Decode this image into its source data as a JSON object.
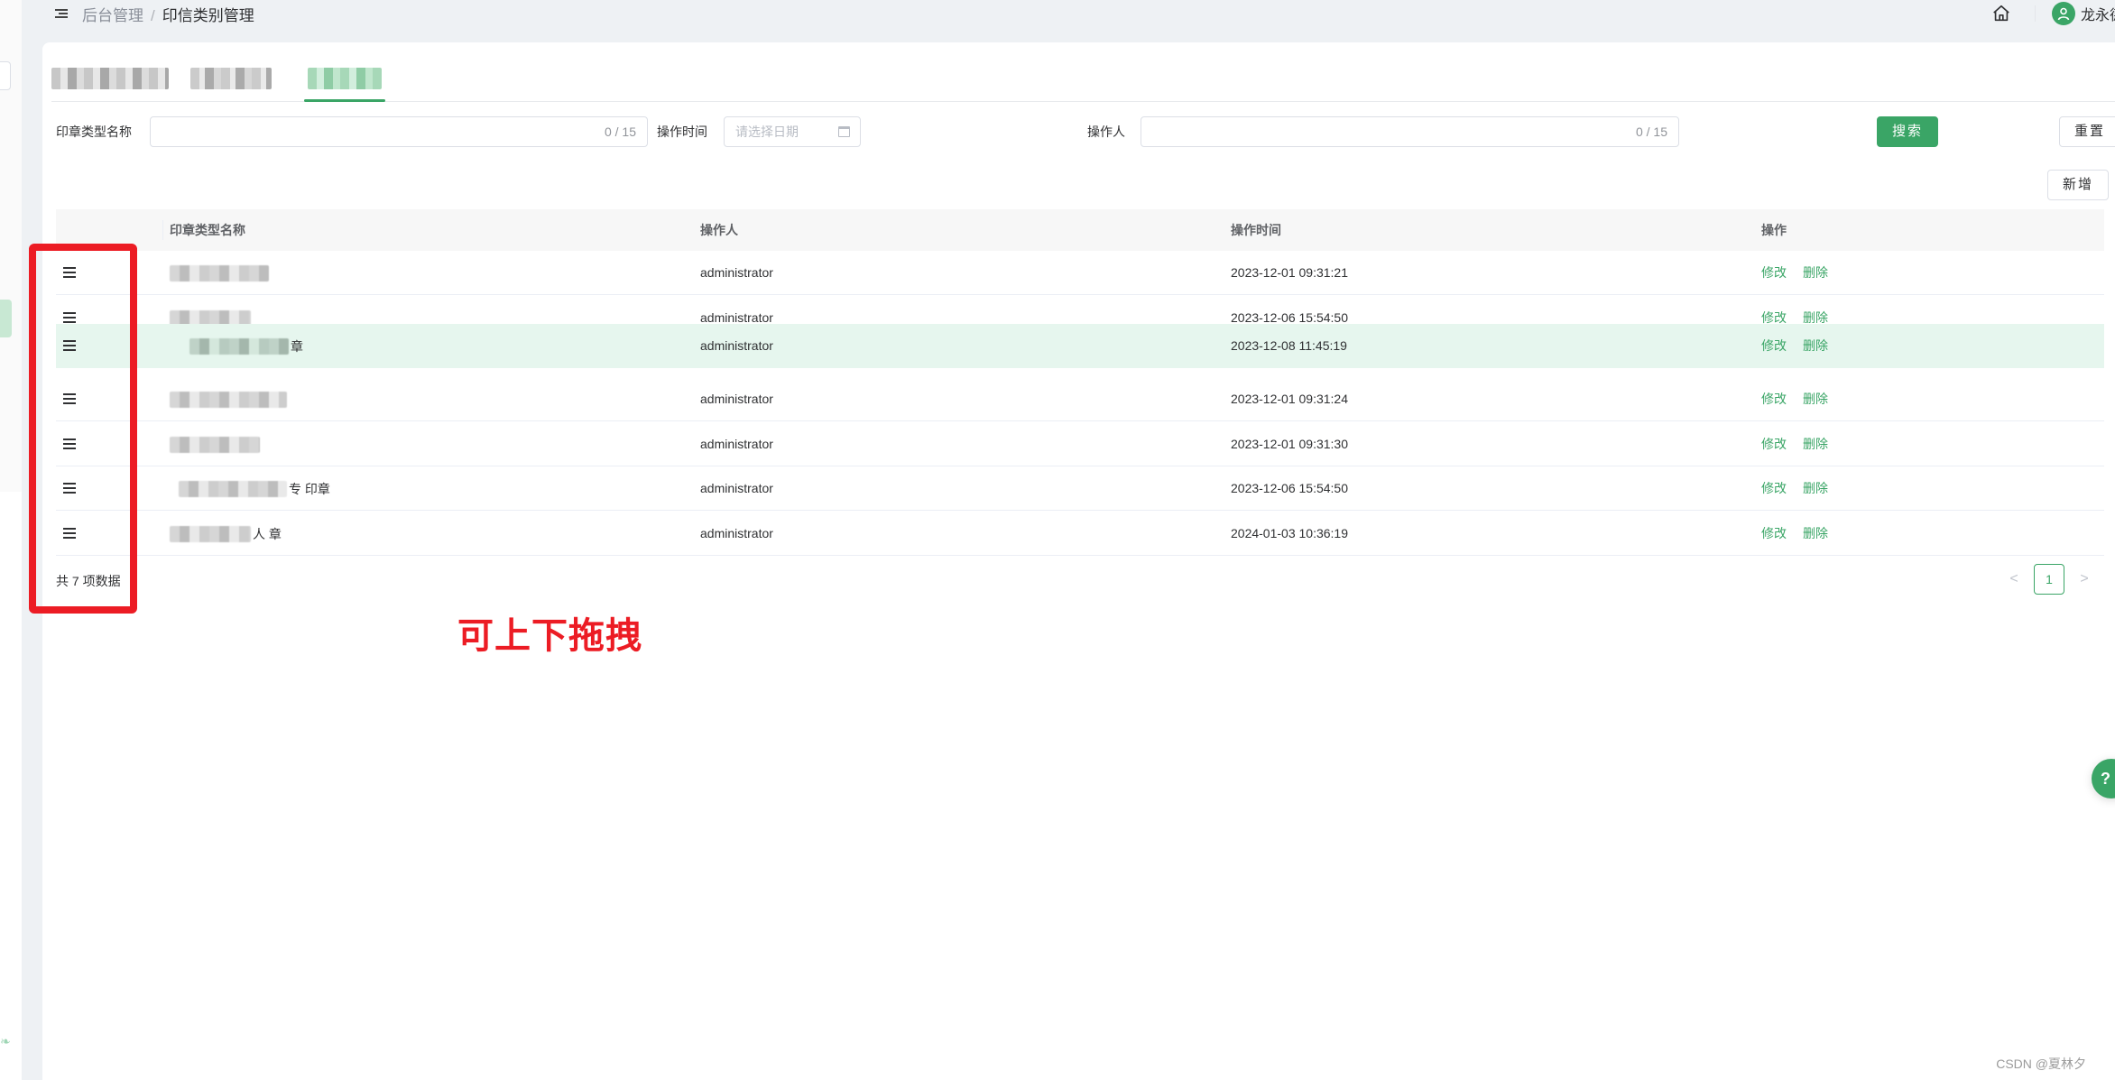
{
  "breadcrumb": {
    "parent": "后台管理",
    "separator": "/",
    "current": "印信类别管理"
  },
  "user": {
    "name": "龙永德"
  },
  "tabs": [
    {
      "label": "[blurred]",
      "active": false
    },
    {
      "label": "[blurred]",
      "active": false
    },
    {
      "label": "[blurred]",
      "active": true
    }
  ],
  "search": {
    "seal_type_label": "印章类型名称",
    "seal_type_value": "",
    "seal_type_count": "0 / 15",
    "op_time_label": "操作时间",
    "op_time_placeholder": "请选择日期",
    "operator_label": "操作人",
    "operator_value": "",
    "operator_count": "0 / 15",
    "search_button": "搜索",
    "reset_button": "重置",
    "add_button": "新增"
  },
  "table": {
    "columns": [
      "印章类型名称",
      "操作人",
      "操作时间",
      "操作"
    ],
    "rows": [
      {
        "name_visible": "",
        "operator": "administrator",
        "time": "2023-12-01 09:31:21",
        "edit": "修改",
        "delete": "删除"
      },
      {
        "name_visible": "",
        "operator": "administrator",
        "time": "2023-12-06 15:54:50",
        "edit": "修改",
        "delete": "删除"
      },
      {
        "name_visible": "章",
        "operator": "administrator",
        "time": "2023-12-08 11:45:19",
        "edit": "修改",
        "delete": "删除",
        "dragging": true
      },
      {
        "name_visible": "",
        "operator": "administrator",
        "time": "2023-12-01 09:31:24",
        "edit": "修改",
        "delete": "删除"
      },
      {
        "name_visible": "",
        "operator": "administrator",
        "time": "2023-12-01 09:31:30",
        "edit": "修改",
        "delete": "删除"
      },
      {
        "name_visible": "专  印章",
        "operator": "administrator",
        "time": "2023-12-06 15:54:50",
        "edit": "修改",
        "delete": "删除"
      },
      {
        "name_visible": "人     章",
        "operator": "administrator",
        "time": "2024-01-03 10:36:19",
        "edit": "修改",
        "delete": "删除"
      }
    ],
    "total_text": "共 7 项数据"
  },
  "pagination": {
    "prev": "<",
    "current_page": "1",
    "next": ">"
  },
  "annotation": {
    "text": "可上下拖拽",
    "color": "#ec1c24"
  },
  "help": {
    "icon": "?"
  },
  "watermark": "CSDN @夏林夕",
  "colors": {
    "primary": "#3aa566",
    "drag_row_bg": "#e6f6ee",
    "page_bg": "#eef1f4"
  }
}
